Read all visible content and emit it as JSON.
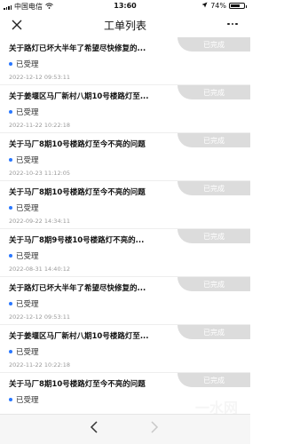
{
  "status_bar": {
    "carrier": "中国电信",
    "time": "13:60",
    "battery": "74%",
    "battery_level": 0.74
  },
  "nav": {
    "title": "工单列表",
    "close_icon": "close-icon",
    "more_icon": "more-icon"
  },
  "items": [
    {
      "title": "关于路灯已坏大半年了希望尽快修复的...",
      "status": "已受理",
      "date": "2022-12-12 09:53:11",
      "badge": "已完成"
    },
    {
      "title": "关于姜堰区马厂新村八期10号楼路灯至...",
      "status": "已受理",
      "date": "2022-11-22 10:22:18",
      "badge": "已完成"
    },
    {
      "title": "关于马厂8期10号楼路灯至今不亮的问题",
      "status": "已受理",
      "date": "2022-10-23 11:12:05",
      "badge": "已完成"
    },
    {
      "title": "关于马厂8期10号楼路灯至今不亮的问题",
      "status": "已受理",
      "date": "2022-09-22 14:34:11",
      "badge": "已完成"
    },
    {
      "title": "关于马厂8期9号楼10号楼路灯不亮的...",
      "status": "已受理",
      "date": "2022-08-31 14:40:12",
      "badge": "已完成"
    },
    {
      "title": "关于路灯已坏大半年了希望尽快修复的...",
      "status": "已受理",
      "date": "2022-12-12 09:53:11",
      "badge": "已完成"
    },
    {
      "title": "关于姜堰区马厂新村八期10号楼路灯至...",
      "status": "已受理",
      "date": "2022-11-22 10:22:18",
      "badge": "已完成"
    },
    {
      "title": "关于马厂8期10号楼路灯至今不亮的问题",
      "status": "已受理",
      "date": "",
      "badge": "已完成"
    }
  ],
  "toolbar": {
    "back_icon": "back-arrow-icon",
    "forward_icon": "forward-arrow-icon"
  }
}
